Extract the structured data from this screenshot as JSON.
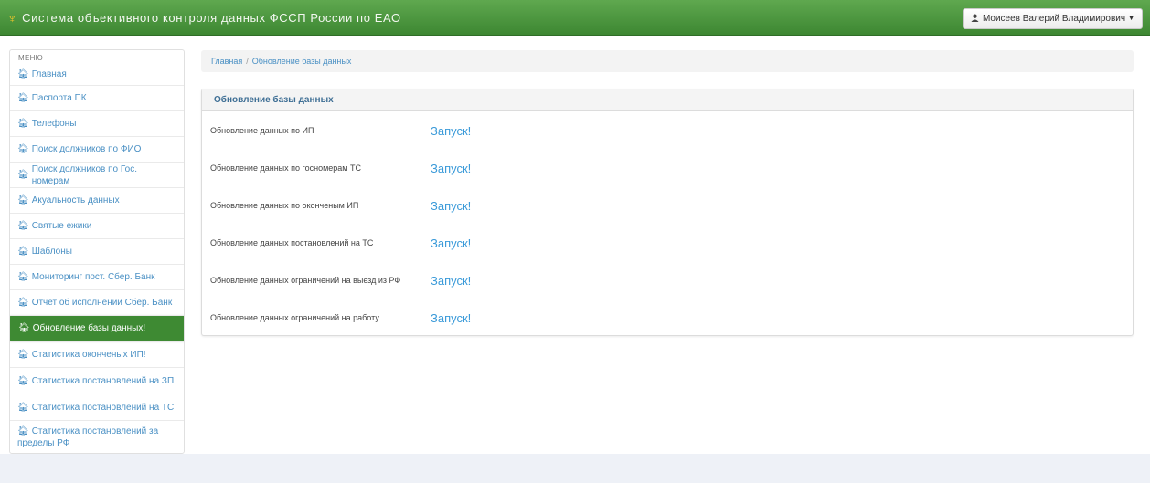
{
  "app": {
    "title": "Система объективного контроля данных ФССП России по ЕАО",
    "brand_icon": "emblem-icon"
  },
  "user": {
    "name": "Моисеев Валерий Владимирович",
    "icon": "user-icon"
  },
  "menu": {
    "header": "МЕНЮ",
    "items": [
      {
        "label": "Главная",
        "active": false
      },
      {
        "label": "Паспорта ПК",
        "active": false
      },
      {
        "label": "Телефоны",
        "active": false
      },
      {
        "label": "Поиск должников по ФИО",
        "active": false
      },
      {
        "label": "Поиск должников по Гос. номерам",
        "active": false
      },
      {
        "label": "Акуальность данных",
        "active": false
      },
      {
        "label": "Святые ежики",
        "active": false
      },
      {
        "label": "Шаблоны",
        "active": false
      },
      {
        "label": "Мониторинг пост. Сбер. Банк",
        "active": false
      },
      {
        "label": "Отчет об исполнении Сбер. Банк",
        "active": false
      },
      {
        "label": "Обновление базы данных!",
        "active": true
      },
      {
        "label": "Статистика оконченых ИП!",
        "active": false
      },
      {
        "label": "Статистика постановлений на ЗП",
        "active": false
      },
      {
        "label": "Статистика постановлений на ТС",
        "active": false
      },
      {
        "label": "Статистика постановлений за пределы РФ",
        "active": false
      }
    ]
  },
  "breadcrumb": {
    "home": "Главная",
    "separator": "/",
    "current": "Обновление базы данных"
  },
  "panel": {
    "title": "Обновление базы данных",
    "rows": [
      {
        "label": "Обновление данных по ИП",
        "action": "Запуск!"
      },
      {
        "label": "Обновление данных по госномерам ТС",
        "action": "Запуск!"
      },
      {
        "label": "Обновление данных по оконченым ИП",
        "action": "Запуск!"
      },
      {
        "label": "Обновление данных постановлений на ТС",
        "action": "Запуск!"
      },
      {
        "label": "Обновление данных ограничений на выезд из РФ",
        "action": "Запуск!"
      },
      {
        "label": "Обновление данных ограничений на работу",
        "action": "Запуск!"
      }
    ]
  },
  "colors": {
    "navbar": "#4a9a3e",
    "active_item": "#3e8a33",
    "link": "#3a9ad9"
  }
}
